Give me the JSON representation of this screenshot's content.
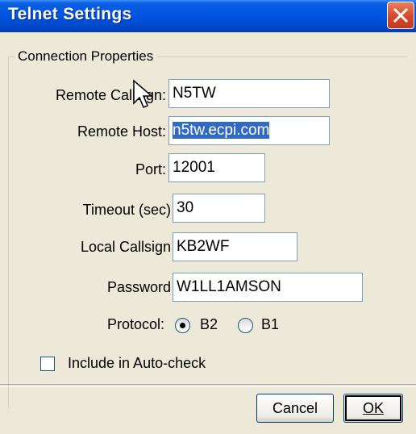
{
  "window": {
    "title": "Telnet Settings"
  },
  "group": {
    "label": "Connection Properties"
  },
  "fields": {
    "remote_callsign": {
      "label": "Remote Callsign:",
      "value": "N5TW"
    },
    "remote_host": {
      "label": "Remote Host:",
      "value": "n5tw.ecpi.com"
    },
    "port": {
      "label": "Port:",
      "value": "12001"
    },
    "timeout": {
      "label": "Timeout (sec)",
      "value": "30"
    },
    "local_callsign": {
      "label": "Local Callsign",
      "value": "KB2WF"
    },
    "password": {
      "label": "Password",
      "value": "W1LL1AMSON"
    }
  },
  "protocol": {
    "label": "Protocol:",
    "options": [
      "B2",
      "B1"
    ],
    "selected": "B2"
  },
  "auto_check": {
    "label": "Include in Auto-check",
    "checked": false
  },
  "buttons": {
    "cancel": "Cancel",
    "ok": "OK"
  },
  "colors": {
    "titlebar": "#0054e3",
    "close": "#d5482a",
    "face": "#ece9d8",
    "selection": "#316ac5"
  }
}
